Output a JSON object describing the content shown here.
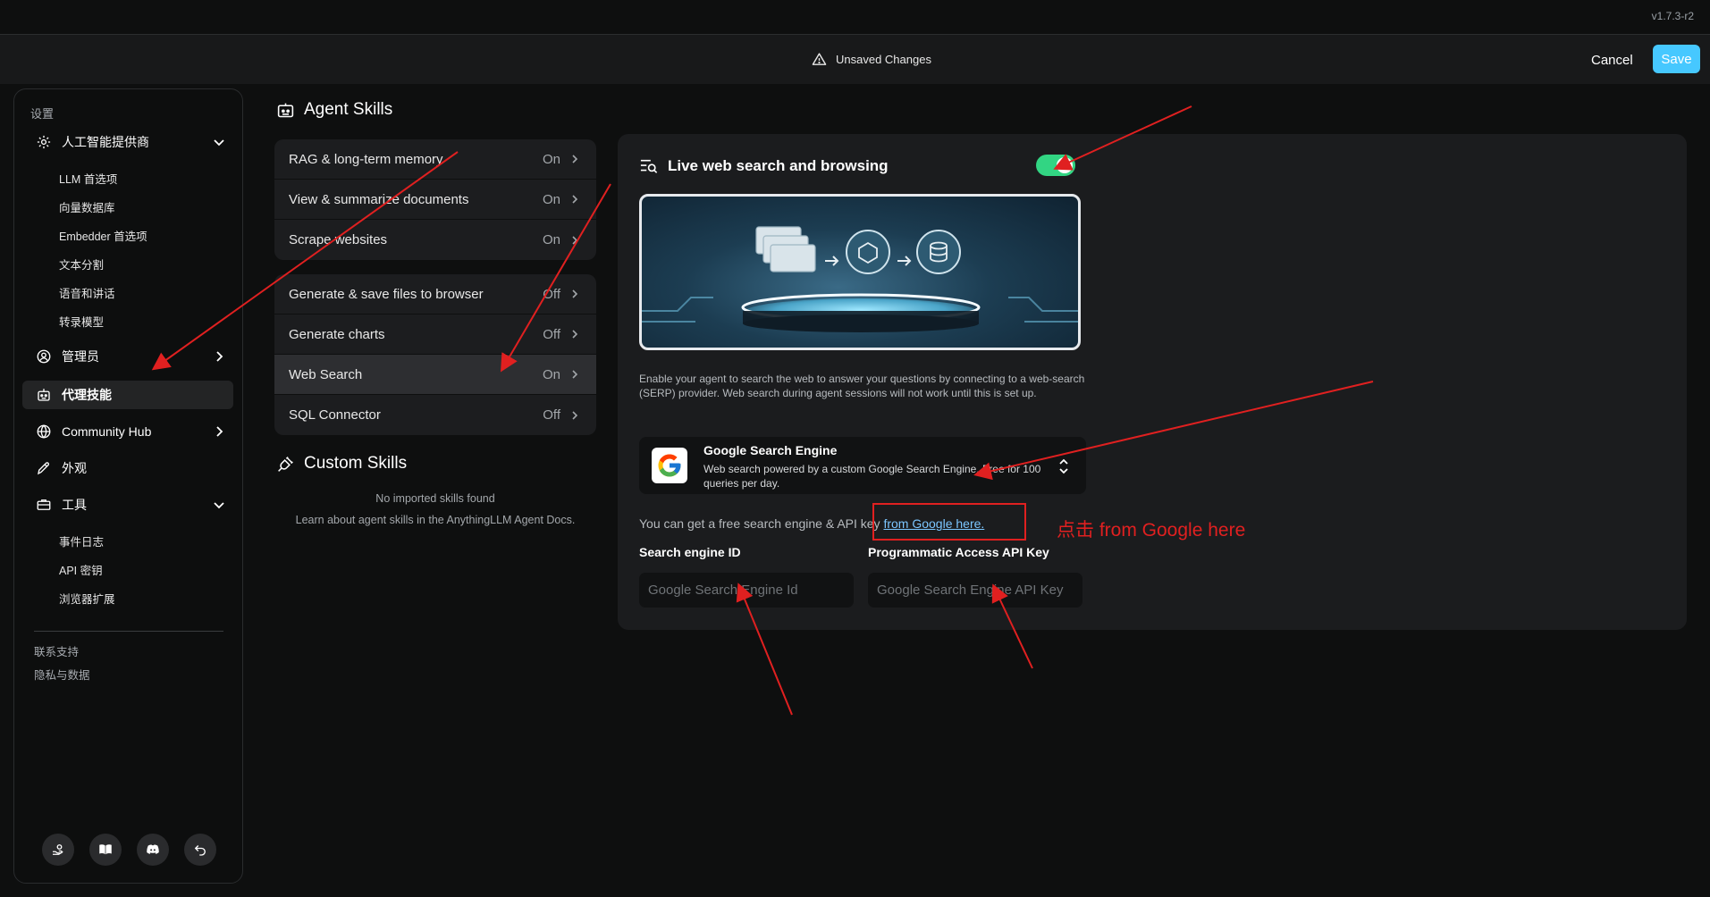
{
  "version": "v1.7.3-r2",
  "topbar": {
    "unsaved_label": "Unsaved Changes",
    "cancel_label": "Cancel",
    "save_label": "Save"
  },
  "sidebar": {
    "title": "设置",
    "items": [
      {
        "label": "人工智能提供商",
        "icon": "gear-icon",
        "chevron": "down"
      },
      {
        "label": "管理员",
        "icon": "user-gear-icon",
        "chevron": "right"
      },
      {
        "label": "代理技能",
        "icon": "robot-icon",
        "active": true
      },
      {
        "label": "Community Hub",
        "icon": "globe-icon",
        "chevron": "right"
      },
      {
        "label": "外观",
        "icon": "pen-icon"
      },
      {
        "label": "工具",
        "icon": "toolbox-icon",
        "chevron": "down"
      }
    ],
    "ai_sub": [
      "LLM 首选项",
      "向量数据库",
      "Embedder 首选项",
      "文本分割",
      "语音和讲话",
      "转录模型"
    ],
    "tools_sub": [
      "事件日志",
      "API 密钥",
      "浏览器扩展"
    ],
    "footer_links": [
      "联系支持",
      "隐私与数据"
    ],
    "bottom_icons": [
      "support-icon",
      "docs-book-icon",
      "discord-icon",
      "back-arrow-icon"
    ]
  },
  "agent_skills": {
    "title": "Agent Skills",
    "default_skills": [
      {
        "label": "RAG & long-term memory",
        "state": "On"
      },
      {
        "label": "View & summarize documents",
        "state": "On"
      },
      {
        "label": "Scrape websites",
        "state": "On"
      }
    ],
    "configurable_skills": [
      {
        "label": "Generate & save files to browser",
        "state": "Off"
      },
      {
        "label": "Generate charts",
        "state": "Off"
      },
      {
        "label": "Web Search",
        "state": "On",
        "selected": true
      },
      {
        "label": "SQL Connector",
        "state": "Off"
      }
    ]
  },
  "custom_skills": {
    "title": "Custom Skills",
    "empty": "No imported skills found",
    "learn": "Learn about agent skills in the AnythingLLM Agent Docs."
  },
  "detail": {
    "title": "Live web search and browsing",
    "enabled": true,
    "description": "Enable your agent to search the web to answer your questions by connecting to a web-search (SERP) provider. Web search during agent sessions will not work until this is set up.",
    "provider": {
      "name": "Google Search Engine",
      "description": "Web search powered by a custom Google Search Engine. Free for 100 queries per day."
    },
    "helper_text": "You can get a free search engine & API key ",
    "helper_link": "from Google here.",
    "engine_id_label": "Search engine ID",
    "engine_id_placeholder": "Google Search Engine Id",
    "api_key_label": "Programmatic Access API Key",
    "api_key_placeholder": "Google Search Engine API Key"
  },
  "annotation": {
    "note": "点击 from Google here",
    "color": "#e02020"
  },
  "colors": {
    "accent": "#46c8ff",
    "toggle_on": "#32d583"
  }
}
